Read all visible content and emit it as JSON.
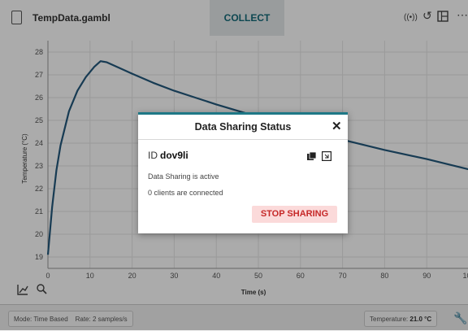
{
  "header": {
    "file_name": "TempData.gambl",
    "collect_label": "COLLECT"
  },
  "icons": {
    "file": "file-icon",
    "broadcast": "broadcast-icon",
    "rotate": "rotate-icon",
    "layout": "layout-icon",
    "more": "more-icon",
    "graph_tools": "graph-tools-icon",
    "zoom": "zoom-icon",
    "copy": "copy-icon",
    "qr": "qr-code-icon",
    "wrench": "wrench-icon"
  },
  "chart_data": {
    "type": "line",
    "xlabel": "Time (s)",
    "ylabel": "Temperature (°C)",
    "xlim": [
      0,
      100
    ],
    "ylim": [
      18.5,
      28.5
    ],
    "x_ticks": [
      "0",
      "10",
      "20",
      "30",
      "40",
      "50",
      "60",
      "70",
      "80",
      "90",
      "100"
    ],
    "y_ticks": [
      "19",
      "20",
      "21",
      "22",
      "23",
      "24",
      "25",
      "26",
      "27",
      "28"
    ],
    "series": [
      {
        "x": [
          0,
          1,
          2,
          3,
          5,
          7,
          9,
          11,
          12.5,
          14,
          17,
          20,
          25,
          30,
          35,
          40,
          50,
          60,
          70,
          80,
          90,
          100
        ],
        "y": [
          19.1,
          21.2,
          22.8,
          23.9,
          25.4,
          26.3,
          26.9,
          27.35,
          27.6,
          27.55,
          27.3,
          27.05,
          26.65,
          26.3,
          26.0,
          25.7,
          25.15,
          24.6,
          24.15,
          23.7,
          23.3,
          22.85
        ]
      }
    ],
    "grid": true,
    "color": "#23587d"
  },
  "footer": {
    "mode": "Mode: Time Based",
    "rate": "Rate: 2 samples/s",
    "temp_label": "Temperature:",
    "temp_value": "21.0 °C"
  },
  "dialog": {
    "title": "Data Sharing Status",
    "close": "✕",
    "id_label": "ID",
    "id_value": "dov9li",
    "status": "Data Sharing is active",
    "clients": "0 clients are connected",
    "stop_label": "STOP SHARING"
  },
  "colors": {
    "accent": "#1e7886",
    "stop_bg": "#fbdada",
    "stop_text": "#c62828"
  }
}
